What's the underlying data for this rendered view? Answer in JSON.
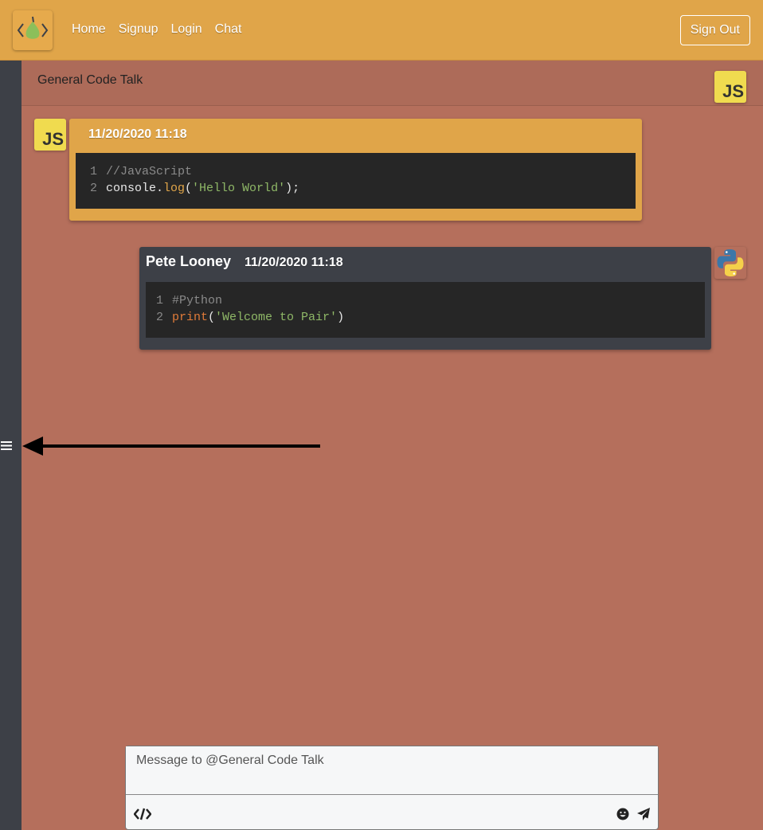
{
  "nav": {
    "links": [
      "Home",
      "Signup",
      "Login",
      "Chat"
    ],
    "signout_label": "Sign Out"
  },
  "channel": {
    "title": "General Code Talk",
    "language_badge": "JS"
  },
  "messages": [
    {
      "author": "",
      "timestamp": "11/20/2020 11:18",
      "language_badge": "JS",
      "code_lines": [
        {
          "num": "1",
          "text": "//JavaScript"
        },
        {
          "num": "2",
          "text": "console.log('Hello World');"
        }
      ]
    },
    {
      "author": "Pete Looney",
      "timestamp": "11/20/2020 11:18",
      "language_icon": "python-icon",
      "code_lines": [
        {
          "num": "1",
          "text": "#Python"
        },
        {
          "num": "2",
          "text": "print('Welcome to Pair')"
        }
      ]
    }
  ],
  "composer": {
    "placeholder": "Message to @General Code Talk"
  },
  "colors": {
    "navbar": "#e0a549",
    "background": "#b56f5c",
    "sidebar": "#3d4047",
    "code_bg": "#262626"
  }
}
